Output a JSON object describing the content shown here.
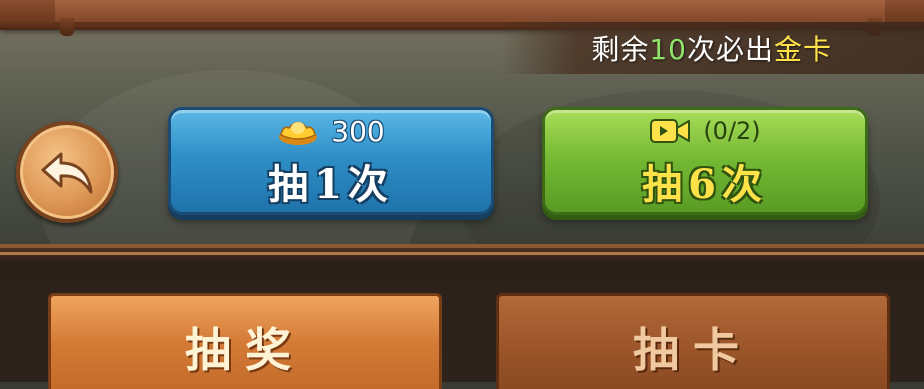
{
  "hint": {
    "prefix": "剩余",
    "count": "10",
    "middle": "次必出",
    "highlight": "金卡"
  },
  "back_button": {
    "icon": "undo-arrow-icon"
  },
  "draw_one": {
    "currency_icon": "gold-ingot-icon",
    "cost": "300",
    "label": "抽1次",
    "color": "#2f8fc7"
  },
  "draw_six": {
    "icon": "video-camera-icon",
    "progress": "(0/2)",
    "label": "抽6次",
    "color": "#73b833"
  },
  "tabs": [
    {
      "label": "抽奖",
      "active": true
    },
    {
      "label": "抽卡",
      "active": false
    }
  ],
  "colors": {
    "hint_number": "#8fe36a",
    "hint_gold": "#ffe14a",
    "draw_six_label": "#ffe24a"
  }
}
